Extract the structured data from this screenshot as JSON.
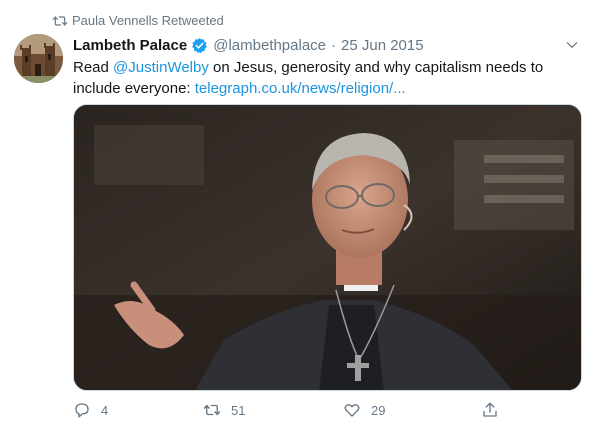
{
  "retweet": {
    "label": "Paula Vennells Retweeted"
  },
  "tweet": {
    "author_name": "Lambeth Palace",
    "handle": "@lambethpalace",
    "separator": "·",
    "date": "25 Jun 2015",
    "text_before": "Read ",
    "mention": "@JustinWelby",
    "text_after": " on Jesus, generosity and why capitalism needs to include everyone: ",
    "url": "telegraph.co.uk/news/religion/..."
  },
  "actions": {
    "replies": "4",
    "retweets": "51",
    "likes": "29"
  },
  "colors": {
    "link": "#1b95e0",
    "verified": "#1da1f2",
    "muted": "#657786",
    "text": "#14171a"
  },
  "icons": [
    "retweet-icon",
    "verified-badge-icon",
    "chevron-down-icon",
    "reply-icon",
    "like-icon",
    "share-icon"
  ]
}
